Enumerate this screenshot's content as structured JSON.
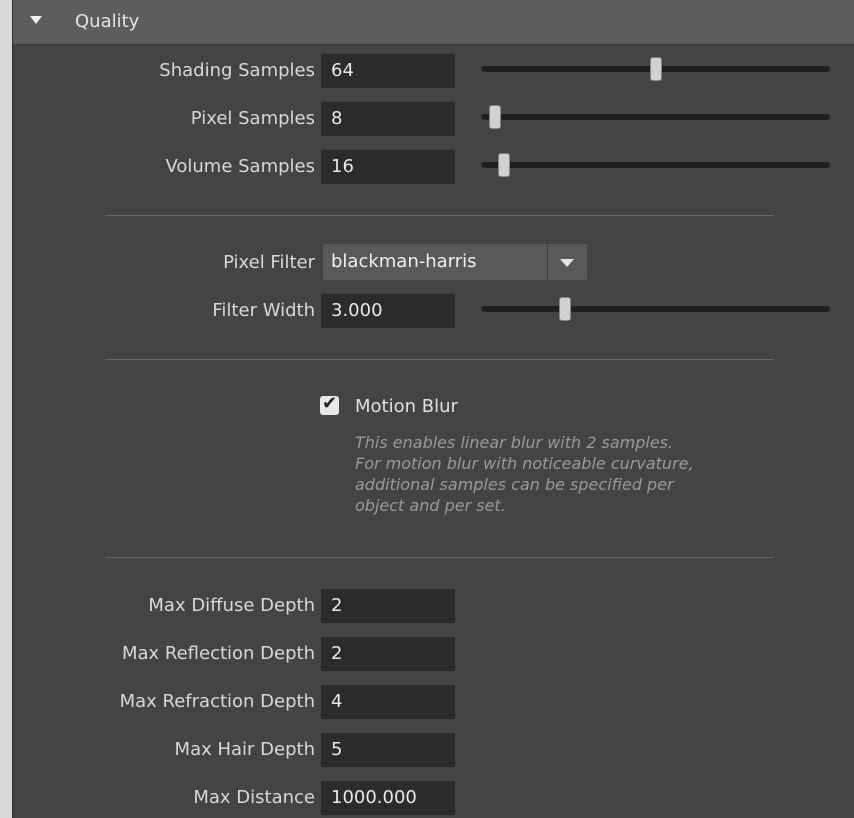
{
  "section": {
    "title": "Quality",
    "collapse_icon": "triangle-down-icon"
  },
  "samples": {
    "shading": {
      "label": "Shading Samples",
      "value": "64",
      "slider_level": 0.5
    },
    "pixel": {
      "label": "Pixel Samples",
      "value": "8",
      "slider_level": 0.04
    },
    "volume": {
      "label": "Volume Samples",
      "value": "16",
      "slider_level": 0.065
    }
  },
  "filter": {
    "pixel_filter_label": "Pixel Filter",
    "pixel_filter_value": "blackman-harris",
    "dropdown_icon": "chevron-down-icon",
    "width_label": "Filter Width",
    "width_value": "3.000",
    "width_slider_level": 0.24
  },
  "motion_blur": {
    "label": "Motion Blur",
    "checked": true,
    "check_icon": "checkmark-icon",
    "note_lines": [
      "This enables linear blur with 2 samples.",
      "For motion blur with noticeable curvature,",
      "additional samples can be specified per",
      "object and per set."
    ]
  },
  "depth": {
    "diffuse": {
      "label": "Max Diffuse Depth",
      "value": "2"
    },
    "reflection": {
      "label": "Max Reflection Depth",
      "value": "2"
    },
    "refraction": {
      "label": "Max Refraction Depth",
      "value": "4"
    },
    "hair": {
      "label": "Max Hair Depth",
      "value": "5"
    },
    "distance": {
      "label": "Max Distance",
      "value": "1000.000"
    }
  },
  "colors": {
    "panel_bg": "#444444",
    "header_bg": "#5d5d5d",
    "field_bg": "#2b2b2b",
    "track": "#1f1f1f",
    "handle": "#d0d0d0",
    "note_text": "#9a9a9a"
  }
}
